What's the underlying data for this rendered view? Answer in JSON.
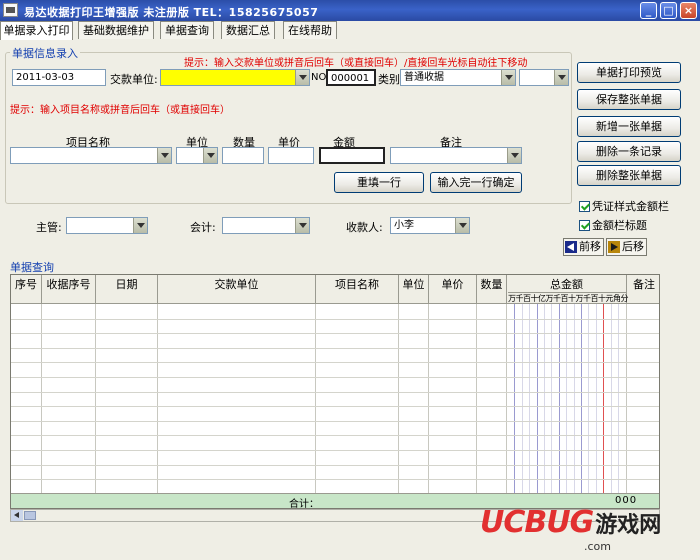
{
  "window": {
    "title": "易达收据打印王增强版  未注册版    TEL：15825675057",
    "min": "_",
    "max": "□",
    "close": "×"
  },
  "tabs": [
    "单据录入打印",
    "基础数据维护",
    "单据查询",
    "数据汇总",
    "在线帮助"
  ],
  "entry": {
    "section_title": "单据信息录入",
    "hint1": "提示：输入交款单位或拼音后回车（或直接回车）/直接回车光标自动往下移动",
    "hint2": "提示：输入项目名称或拼音后回车（或直接回车）",
    "date": "2011-03-03",
    "payer_label": "交款单位:",
    "payer_value": "",
    "no_label": "NO.",
    "no_value": "000001",
    "category_label": "类别",
    "category_value": "普通收据",
    "category_extra": ""
  },
  "items": {
    "headers": {
      "name": "项目名称",
      "unit": "单位",
      "qty": "数量",
      "price": "单价",
      "amount": "金额",
      "note": "备注"
    },
    "reset_button": "重填一行",
    "confirm_button": "输入完一行确定"
  },
  "signers": {
    "manager_label": "主管:",
    "manager_value": "",
    "accountant_label": "会计:",
    "accountant_value": "",
    "payee_label": "收款人:",
    "payee_value": "小李"
  },
  "actions": [
    "单据打印预览",
    "保存整张单据",
    "新增一张单据",
    "删除一条记录",
    "删除整张单据"
  ],
  "options": {
    "voucher_style": "凭证样式金额栏",
    "amount_title": "金额栏标题"
  },
  "nav": {
    "prev": "前移",
    "next": "后移"
  },
  "query": {
    "section_title": "单据查询",
    "headers": [
      "序号",
      "收据序号",
      "日期",
      "交款单位",
      "项目名称",
      "单位",
      "单价",
      "数量",
      "总金额",
      "备注"
    ],
    "digit_header": "万千百十亿万千百十万千百十元角分",
    "total_label": "合计：",
    "total_value": "000"
  },
  "watermark": {
    "brand": "UCBUG",
    "cn": "游戏网",
    "url": ".com"
  },
  "colors": {
    "titlebar": "#2b4ea8",
    "hint": "#e00000",
    "section": "#1440b0",
    "highlight": "#ffff00",
    "subtotal": "#c8e6c8"
  }
}
